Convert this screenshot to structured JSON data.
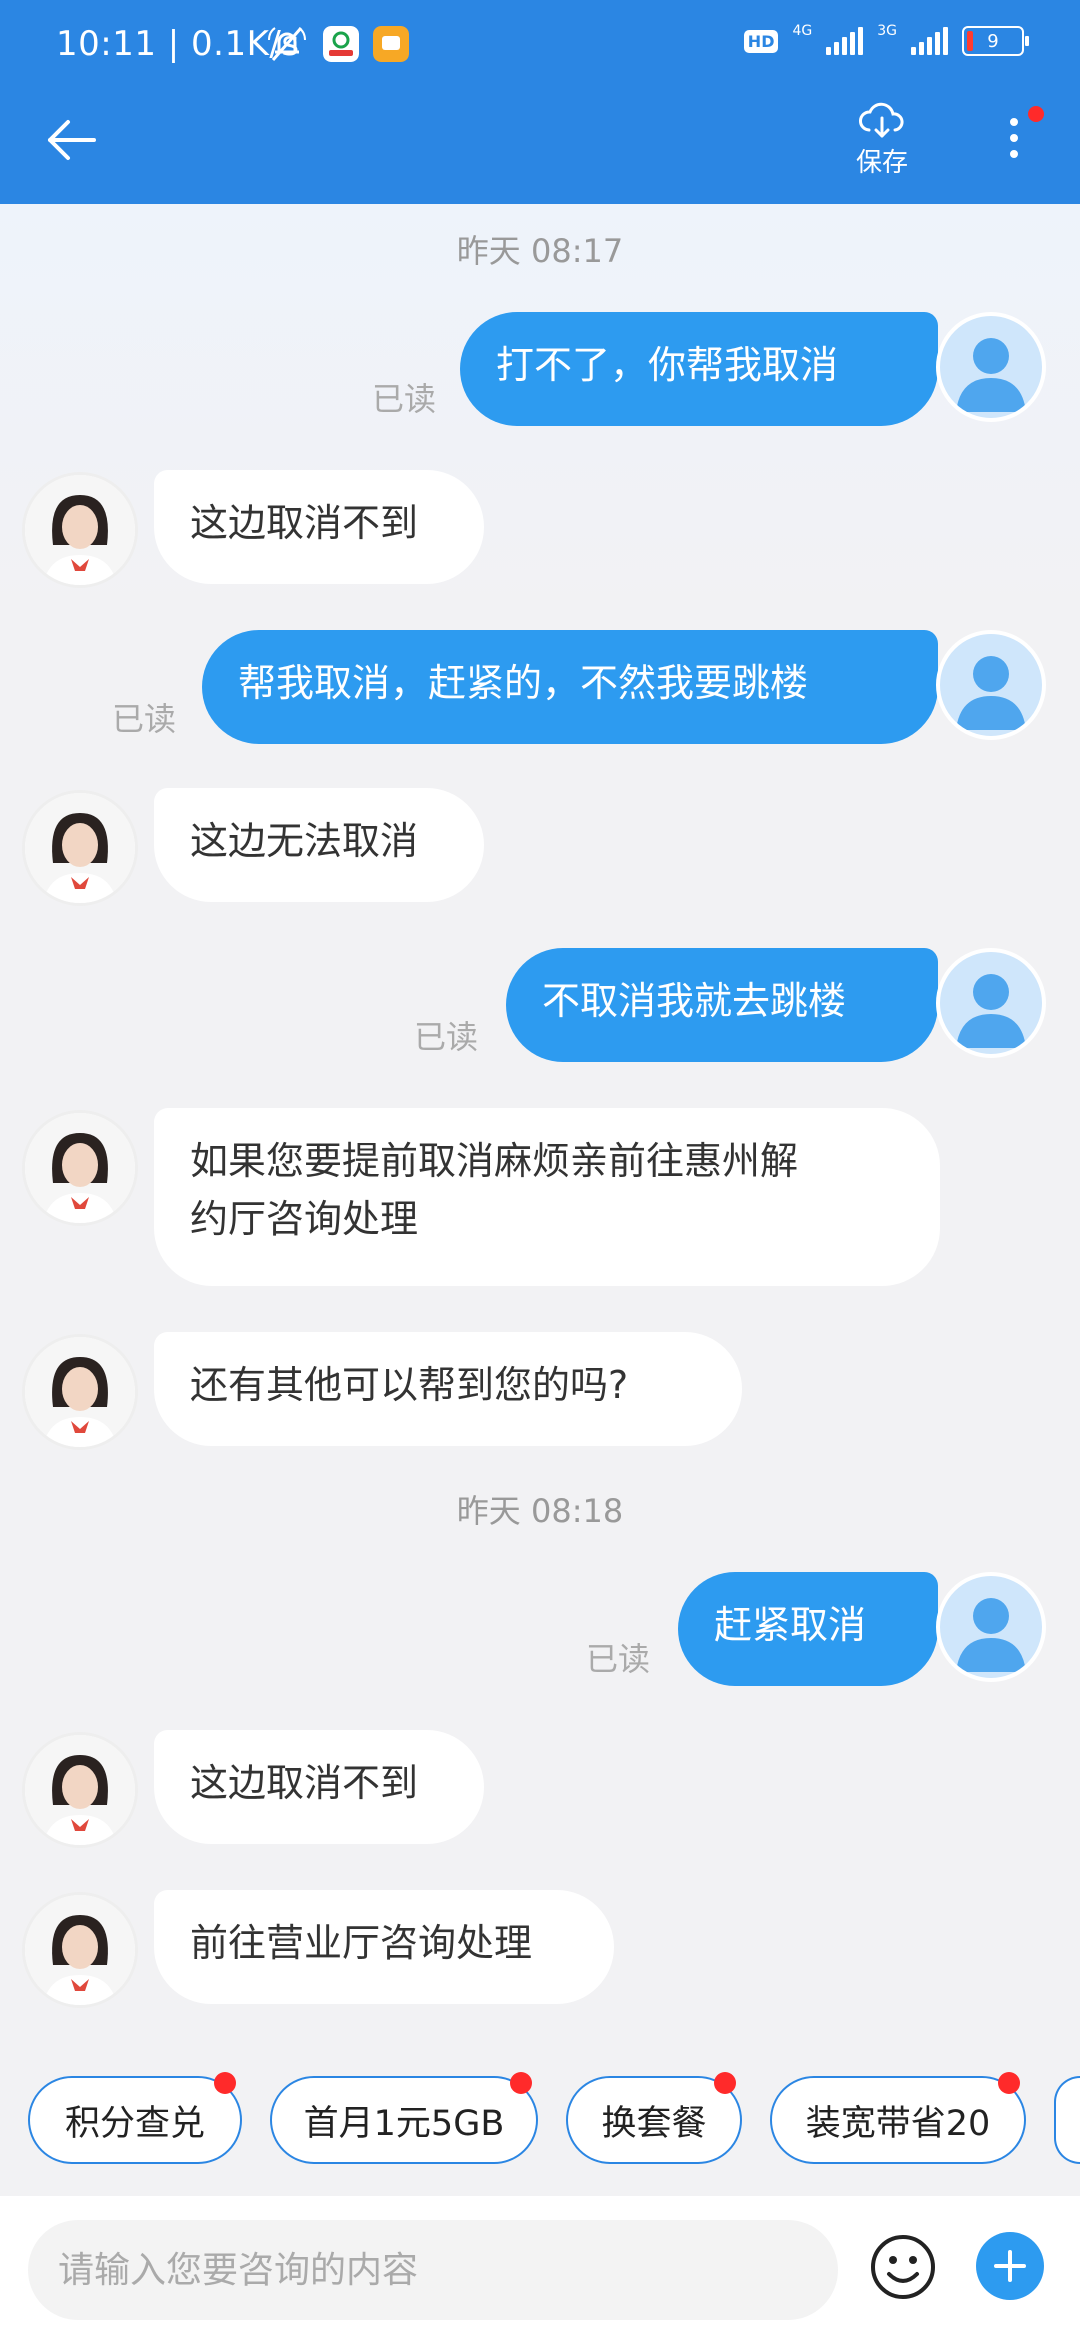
{
  "status_bar": {
    "time_speed": "10:11 | 0.1K/s",
    "hd": "HD",
    "net1": "4G",
    "net2": "3G",
    "battery": "9",
    "battery_level": 0.09
  },
  "header": {
    "save_label": "保存",
    "back_icon": "arrow-left-icon",
    "save_icon": "cloud-download-icon",
    "more_icon": "more-vertical-icon",
    "colors": {
      "bar": "#2b86e3",
      "badge": "#ff2a2a"
    }
  },
  "chat": {
    "time1": "昨天 08:17",
    "time2": "昨天 08:18",
    "read_label": "已读",
    "messages": [
      {
        "from": "user",
        "text": "打不了，你帮我取消"
      },
      {
        "from": "agent",
        "text": "这边取消不到"
      },
      {
        "from": "user",
        "text": "帮我取消，赶紧的，不然我要跳楼"
      },
      {
        "from": "agent",
        "text": "这边无法取消"
      },
      {
        "from": "user",
        "text": "不取消我就去跳楼"
      },
      {
        "from": "agent",
        "line1": "如果您要提前取消麻烦亲前往惠州解",
        "line2": "约厅咨询处理"
      },
      {
        "from": "agent",
        "text": "还有其他可以帮到您的吗?"
      },
      {
        "from": "user",
        "text": "赶紧取消"
      },
      {
        "from": "agent",
        "text": "这边取消不到"
      },
      {
        "from": "agent",
        "text": "前往营业厅咨询处理"
      }
    ],
    "colors": {
      "user_bubble": "#2d9bf0",
      "agent_bubble": "#ffffff"
    }
  },
  "quick_replies": [
    {
      "label": "积分查兑"
    },
    {
      "label": "首月1元5GB"
    },
    {
      "label": "换套餐"
    },
    {
      "label": "装宽带省20"
    }
  ],
  "input_bar": {
    "placeholder": "请输入您要咨询的内容",
    "emoji_icon": "smiley-icon",
    "plus_icon": "plus-icon"
  }
}
